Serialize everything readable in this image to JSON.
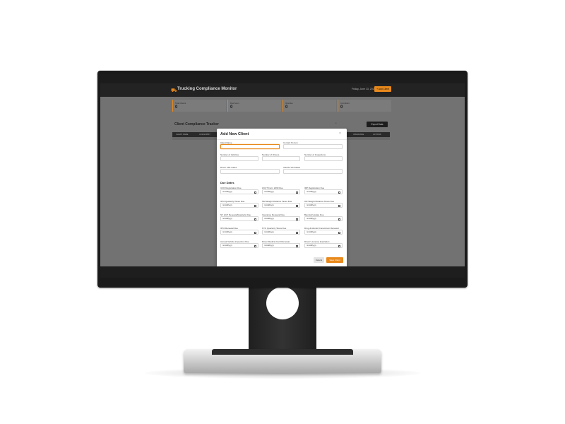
{
  "app": {
    "logo_icon": "truck-icon",
    "title": "Trucking Compliance Monitor",
    "date": "Friday, June 13, 2025",
    "add_button": "+ Add Client",
    "accent_color": "#e8891c",
    "stats": [
      {
        "label": "Total Clients",
        "value": "0"
      },
      {
        "label": "Due Soon",
        "value": "0"
      },
      {
        "label": "Overdue",
        "value": "0"
      },
      {
        "label": "Compliant",
        "value": "0"
      }
    ],
    "section_title": "Client Compliance Tracker",
    "filter_value": "s",
    "export_button": "Export Data",
    "table_headers": [
      "CLIENT NAME",
      "UCR EXPIRY",
      "INSURANCE",
      "ACTIONS"
    ]
  },
  "modal": {
    "title": "Add New Client",
    "close_icon": "×",
    "fields": {
      "client_name": "Client Name",
      "contact_person": "Contact Person",
      "num_vehicles": "Number of Vehicles",
      "num_drivers": "Number of Drivers",
      "num_inspections": "Number of Inspections",
      "driver_cdl_dates": "Driver CDL Dates",
      "vehicle_vin_dates": "Vehicle VIN Dates"
    },
    "due_dates_title": "Due Dates",
    "date_placeholder": "mm/dd/yyyy",
    "due_dates": [
      "UCR Registration Due",
      "HVUT Form 2290 Due",
      "IRP Registration Due",
      "IFTA Quarterly Taxes Due",
      "NM Weight Distance Taxes Due",
      "OR Weight Distance Taxes Due",
      "NY HUT Renewal/Quarterly Due",
      "Insurance Renewal Due",
      "Biennial Update Due",
      "IFTA Renewal Due",
      "KYU Quarterly Taxes Due",
      "Drug & Alcohol Consortium Renewal",
      "Annual Vehicle Inspection Due",
      "Driver Medical Card Renewal",
      "Driver's License Expiration"
    ],
    "cancel_button": "Cancel",
    "save_button": "Save Client"
  }
}
